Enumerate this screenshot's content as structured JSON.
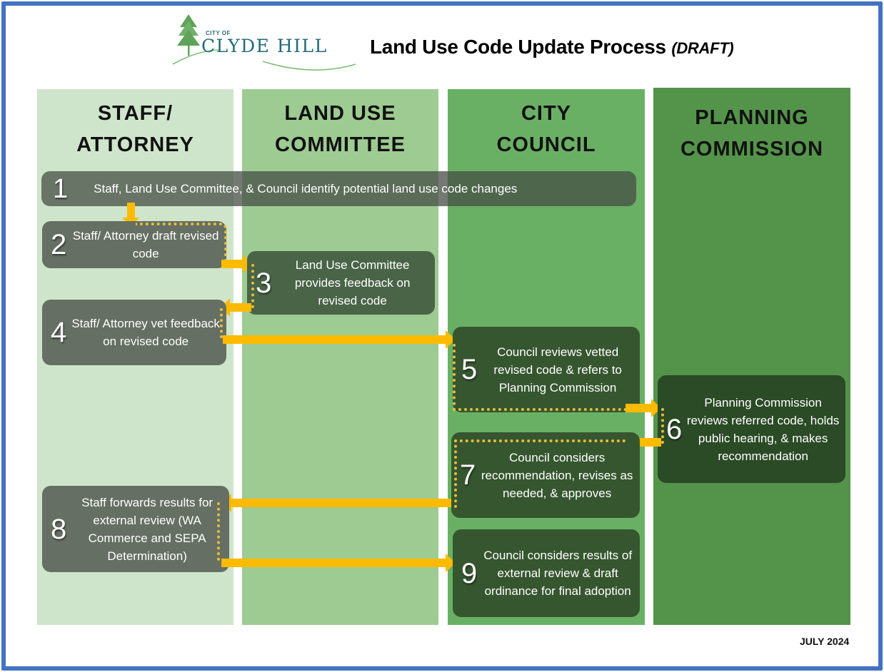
{
  "header": {
    "logo_city_of": "CITY OF",
    "logo_name": "CLYDE HILL",
    "title": "Land Use Code Update Process",
    "title_suffix": "(DRAFT)"
  },
  "lanes": [
    {
      "line1": "STAFF/",
      "line2": "ATTORNEY"
    },
    {
      "line1": "LAND USE",
      "line2": "COMMITTEE"
    },
    {
      "line1": "CITY",
      "line2": "COUNCIL"
    },
    {
      "line1": "PLANNING",
      "line2": "COMMISSION"
    }
  ],
  "steps": [
    {
      "num": "1",
      "text": "Staff, Land Use Committee, & Council identify potential land use code changes"
    },
    {
      "num": "2",
      "text": "Staff/ Attorney draft revised code"
    },
    {
      "num": "3",
      "text": "Land Use Committee provides feedback on revised code"
    },
    {
      "num": "4",
      "text": "Staff/ Attorney vet feedback on revised code"
    },
    {
      "num": "5",
      "text": "Council reviews vetted revised code & refers to Planning Commission"
    },
    {
      "num": "6",
      "text": "Planning Commission reviews referred code, holds public hearing, & makes recommendation"
    },
    {
      "num": "7",
      "text": "Council considers recommendation, revises as needed, & approves"
    },
    {
      "num": "8",
      "text": "Staff forwards results for external review (WA Commerce and SEPA Determination)"
    },
    {
      "num": "9",
      "text": "Council considers results of external review & draft ordinance for final adoption"
    }
  ],
  "colors": {
    "frame": "#4472c4",
    "arrow": "#fdbb00",
    "lane_staff": "#cfe5cb",
    "lane_committee": "#9dcb92",
    "lane_council": "#6ab064",
    "lane_commission": "#54944a"
  },
  "footer": {
    "date": "JULY 2024"
  }
}
